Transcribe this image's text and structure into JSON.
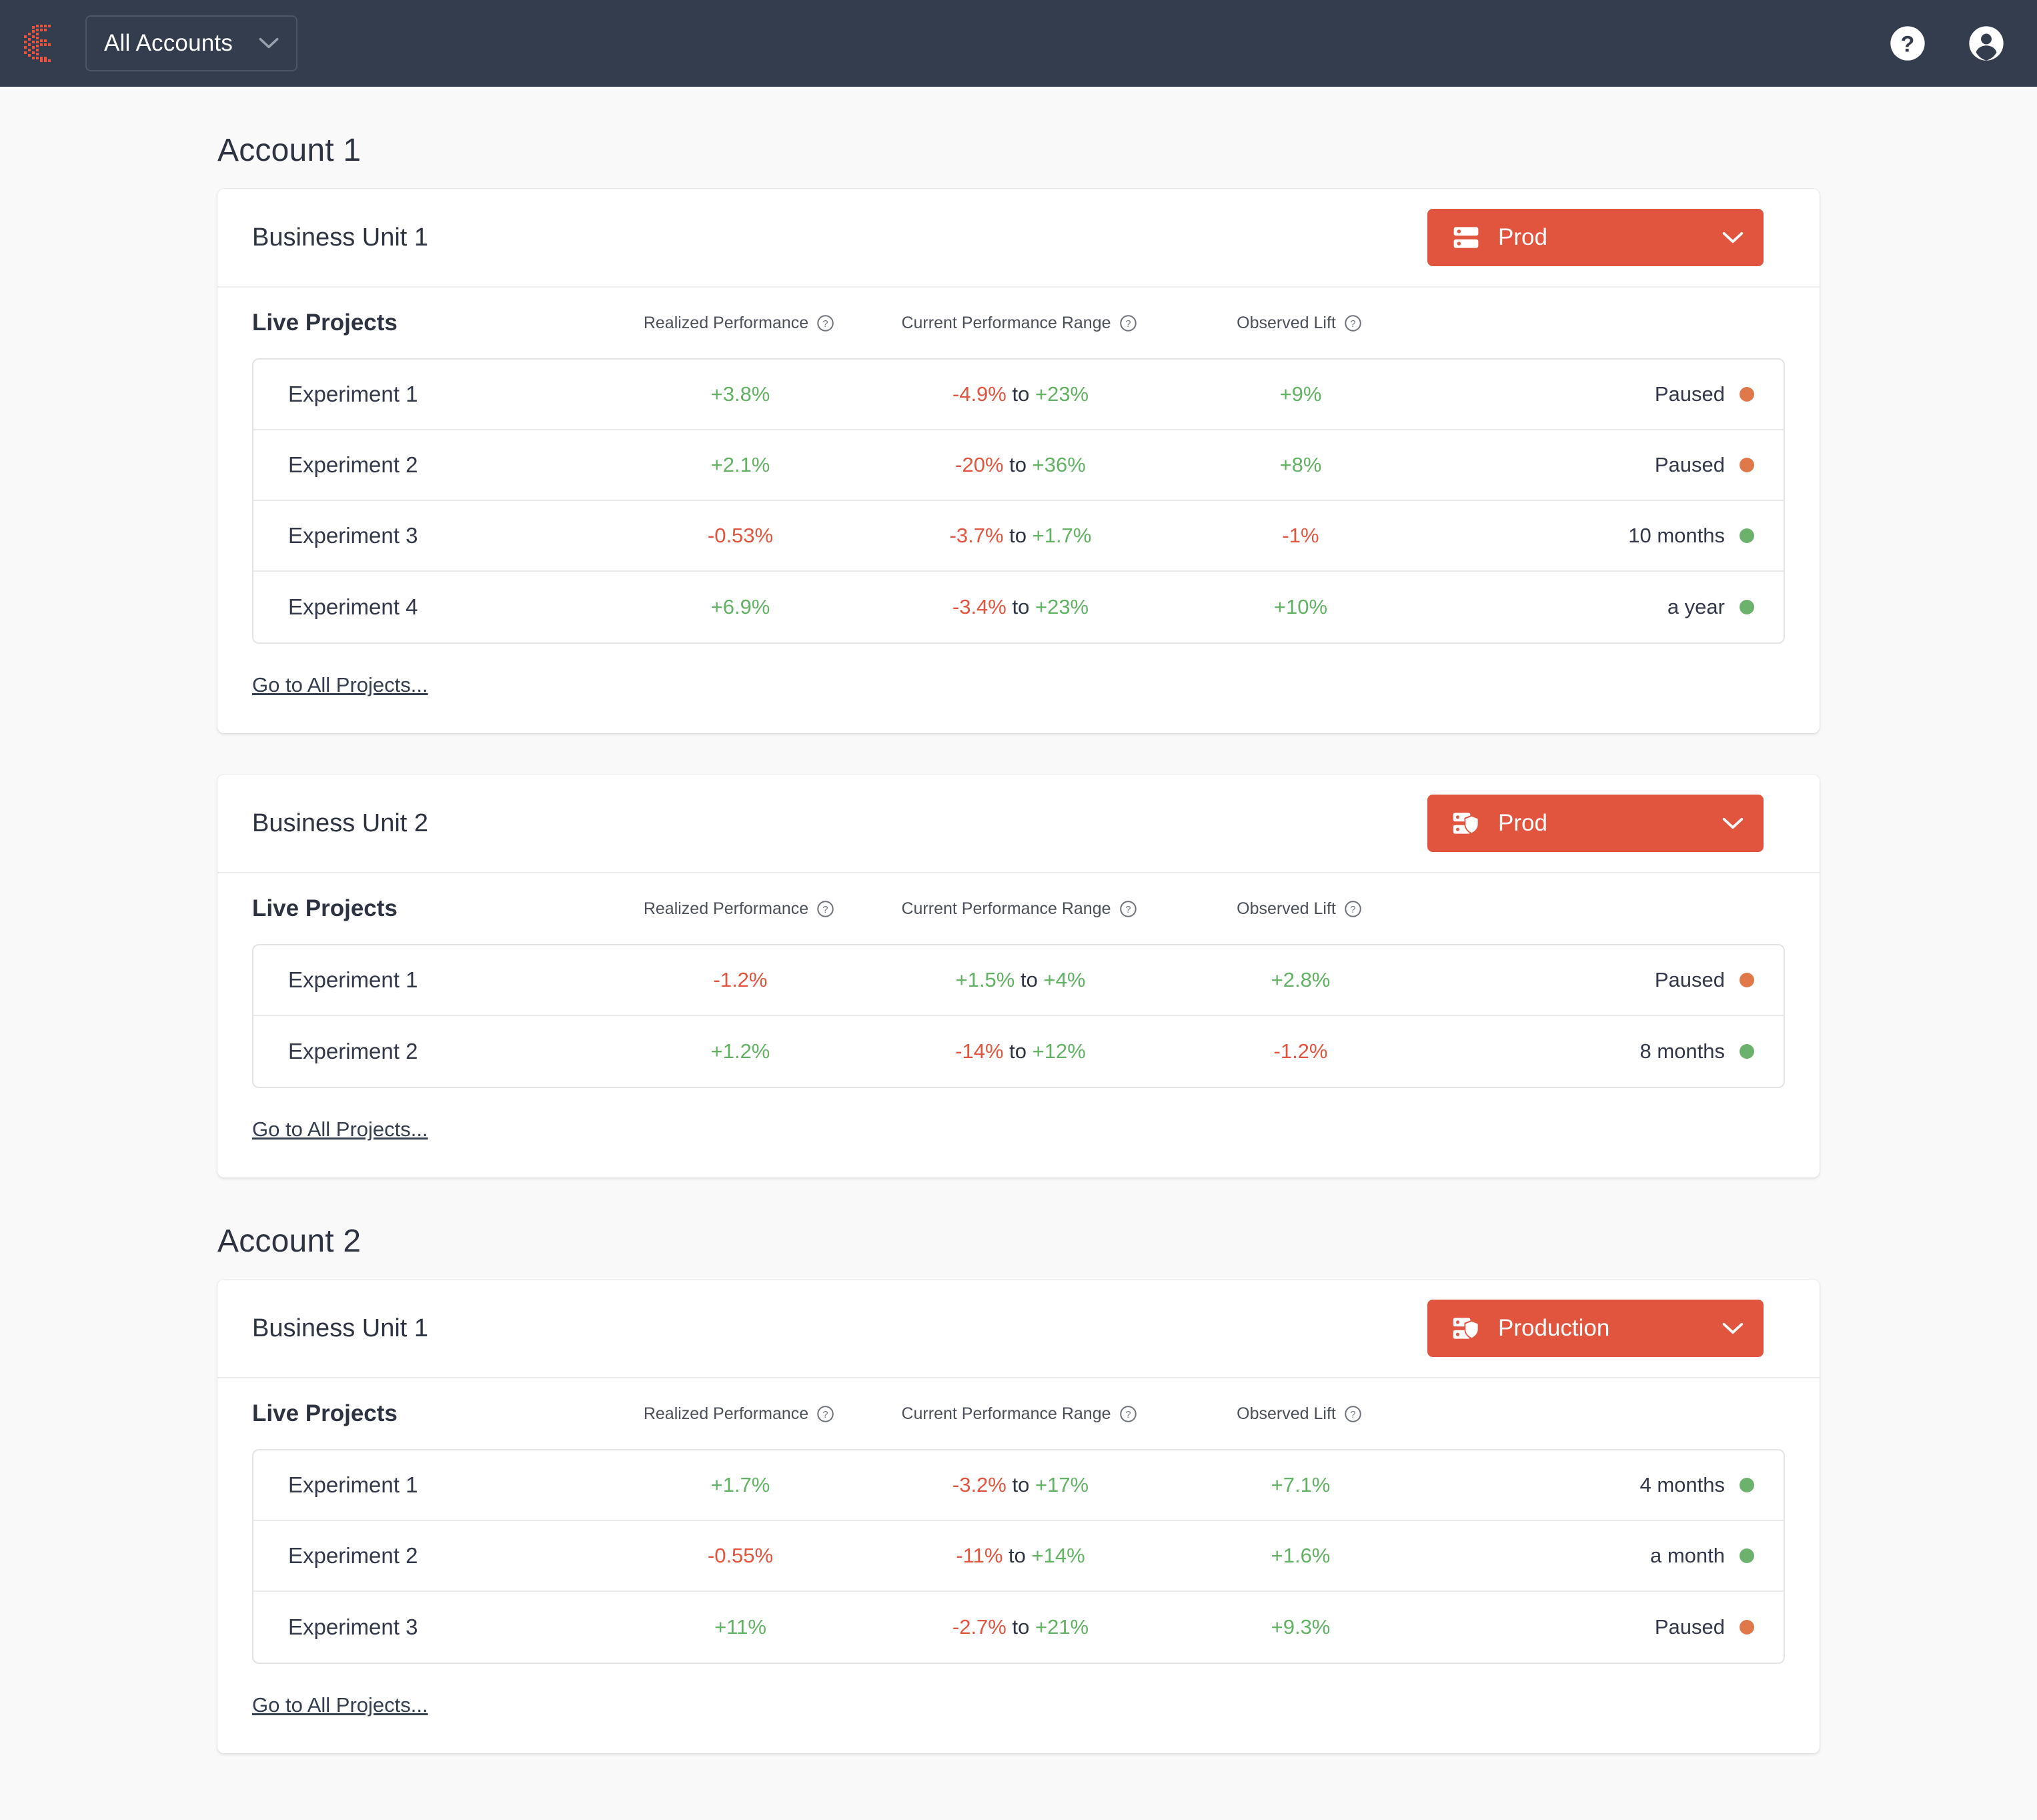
{
  "topbar": {
    "logo_name": "evolv-logo",
    "account_selector": {
      "value": "All Accounts",
      "icon": "chevron-down-icon"
    },
    "help_icon": "help-circle-icon",
    "profile_icon": "account-circle-icon",
    "bg_color": "#343d4d"
  },
  "colors": {
    "accent": "#e1553f",
    "positive": "#62b263",
    "negative": "#e1553f",
    "paused_dot": "#e0794a",
    "active_dot": "#6cb26c",
    "page_bg": "#f9f9fa"
  },
  "columns": {
    "name": "Live Projects",
    "realized_performance": "Realized Performance",
    "current_performance_range": "Current Performance Range",
    "observed_lift": "Observed Lift",
    "help_icon": "help-circle-outline-icon",
    "range_separator": "to"
  },
  "links": {
    "all_projects": "Go to All Projects..."
  },
  "accounts": [
    {
      "title": "Account 1",
      "business_units": [
        {
          "title": "Business Unit 1",
          "env": {
            "label": "Prod",
            "icon": "server-icon",
            "chevron": "chevron-down-icon"
          },
          "rows": [
            {
              "name": "Experiment 1",
              "realized": "+3.8%",
              "realized_sign": "pos",
              "range_low": "-4.9%",
              "range_low_sign": "neg",
              "range_high": "+23%",
              "range_high_sign": "pos",
              "lift": "+9%",
              "lift_sign": "pos",
              "status": "Paused",
              "status_state": "paused"
            },
            {
              "name": "Experiment 2",
              "realized": "+2.1%",
              "realized_sign": "pos",
              "range_low": "-20%",
              "range_low_sign": "neg",
              "range_high": "+36%",
              "range_high_sign": "pos",
              "lift": "+8%",
              "lift_sign": "pos",
              "status": "Paused",
              "status_state": "paused"
            },
            {
              "name": "Experiment 3",
              "realized": "-0.53%",
              "realized_sign": "neg",
              "range_low": "-3.7%",
              "range_low_sign": "neg",
              "range_high": "+1.7%",
              "range_high_sign": "pos",
              "lift": "-1%",
              "lift_sign": "neg",
              "status": "10 months",
              "status_state": "active"
            },
            {
              "name": "Experiment 4",
              "realized": "+6.9%",
              "realized_sign": "pos",
              "range_low": "-3.4%",
              "range_low_sign": "neg",
              "range_high": "+23%",
              "range_high_sign": "pos",
              "lift": "+10%",
              "lift_sign": "pos",
              "status": "a year",
              "status_state": "active"
            }
          ]
        },
        {
          "title": "Business Unit 2",
          "env": {
            "label": "Prod",
            "icon": "server-shield-icon",
            "chevron": "chevron-down-icon"
          },
          "rows": [
            {
              "name": "Experiment 1",
              "realized": "-1.2%",
              "realized_sign": "neg",
              "range_low": "+1.5%",
              "range_low_sign": "pos",
              "range_high": "+4%",
              "range_high_sign": "pos",
              "lift": "+2.8%",
              "lift_sign": "pos",
              "status": "Paused",
              "status_state": "paused"
            },
            {
              "name": "Experiment 2",
              "realized": "+1.2%",
              "realized_sign": "pos",
              "range_low": "-14%",
              "range_low_sign": "neg",
              "range_high": "+12%",
              "range_high_sign": "pos",
              "lift": "-1.2%",
              "lift_sign": "neg",
              "status": "8 months",
              "status_state": "active"
            }
          ]
        }
      ]
    },
    {
      "title": "Account 2",
      "business_units": [
        {
          "title": "Business Unit 1",
          "env": {
            "label": "Production",
            "icon": "server-shield-icon",
            "chevron": "chevron-down-icon"
          },
          "rows": [
            {
              "name": "Experiment 1",
              "realized": "+1.7%",
              "realized_sign": "pos",
              "range_low": "-3.2%",
              "range_low_sign": "neg",
              "range_high": "+17%",
              "range_high_sign": "pos",
              "lift": "+7.1%",
              "lift_sign": "pos",
              "status": "4 months",
              "status_state": "active"
            },
            {
              "name": "Experiment 2",
              "realized": "-0.55%",
              "realized_sign": "neg",
              "range_low": "-11%",
              "range_low_sign": "neg",
              "range_high": "+14%",
              "range_high_sign": "pos",
              "lift": "+1.6%",
              "lift_sign": "pos",
              "status": "a month",
              "status_state": "active"
            },
            {
              "name": "Experiment 3",
              "realized": "+11%",
              "realized_sign": "pos",
              "range_low": "-2.7%",
              "range_low_sign": "neg",
              "range_high": "+21%",
              "range_high_sign": "pos",
              "lift": "+9.3%",
              "lift_sign": "pos",
              "status": "Paused",
              "status_state": "paused"
            }
          ]
        }
      ]
    }
  ]
}
